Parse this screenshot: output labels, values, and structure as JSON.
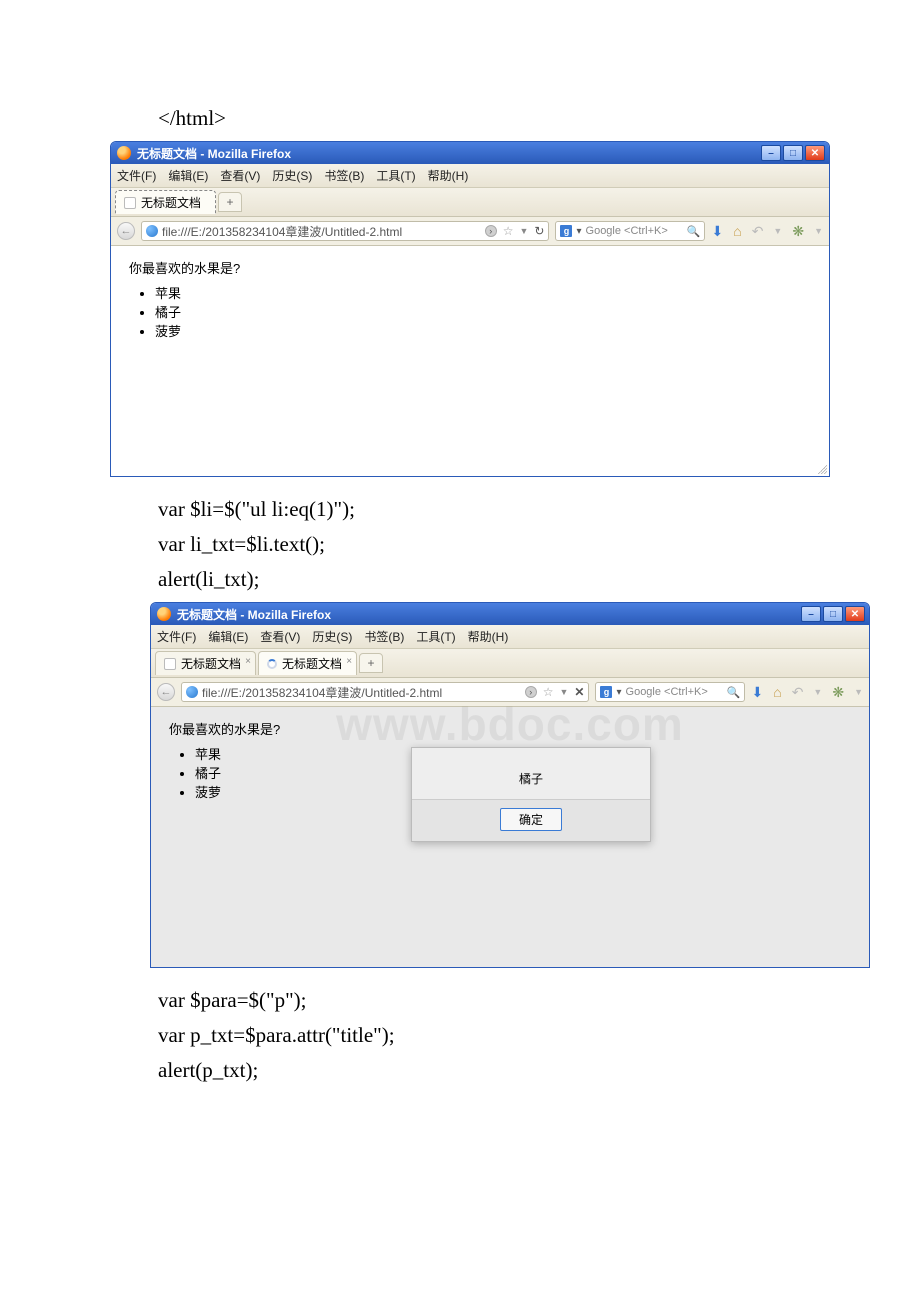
{
  "code_above": "</html>",
  "code_mid": [
    "var $li=$(\"ul li:eq(1)\");",
    "var li_txt=$li.text();",
    "alert(li_txt);"
  ],
  "code_bottom": [
    "var $para=$(\"p\");",
    "var p_txt=$para.attr(\"title\");",
    "alert(p_txt);"
  ],
  "window1": {
    "title": "无标题文档 - Mozilla Firefox",
    "menus": [
      "文件(F)",
      "编辑(E)",
      "查看(V)",
      "历史(S)",
      "书签(B)",
      "工具(T)",
      "帮助(H)"
    ],
    "tab_label": "无标题文档",
    "url": "file:///E:/201358234104章建波/Untitled-2.html",
    "search_placeholder": "Google <Ctrl+K>",
    "content": {
      "heading": "你最喜欢的水果是?",
      "items": [
        "苹果",
        "橘子",
        "菠萝"
      ]
    }
  },
  "window2": {
    "title": "无标题文档 - Mozilla Firefox",
    "menus": [
      "文件(F)",
      "编辑(E)",
      "查看(V)",
      "历史(S)",
      "书签(B)",
      "工具(T)",
      "帮助(H)"
    ],
    "tab1_label": "无标题文档",
    "tab2_label": "无标题文档",
    "url": "file:///E:/201358234104章建波/Untitled-2.html",
    "search_placeholder": "Google <Ctrl+K>",
    "content": {
      "heading": "你最喜欢的水果是?",
      "items": [
        "苹果",
        "橘子",
        "菠萝"
      ]
    },
    "alert_text": "橘子",
    "alert_ok": "确定",
    "watermark": "www.bdoc.com"
  }
}
